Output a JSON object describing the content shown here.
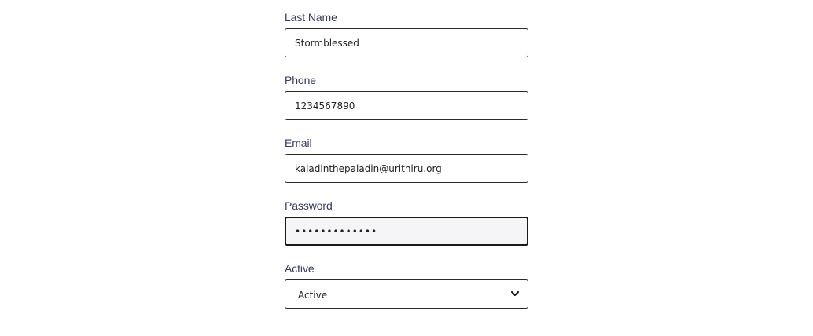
{
  "form": {
    "last_name": {
      "label": "Last Name",
      "value": "Stormblessed"
    },
    "phone": {
      "label": "Phone",
      "value": "1234567890"
    },
    "email": {
      "label": "Email",
      "value": "kaladinthepaladin@urithiru.org"
    },
    "password": {
      "label": "Password",
      "value": "•••••••••••••"
    },
    "active": {
      "label": "Active",
      "selected": "Active",
      "icon": "chevron-down-icon"
    }
  },
  "colors": {
    "label": "#363b5c",
    "border": "#2a2a2a",
    "focused_background": "#f5f5f7"
  }
}
